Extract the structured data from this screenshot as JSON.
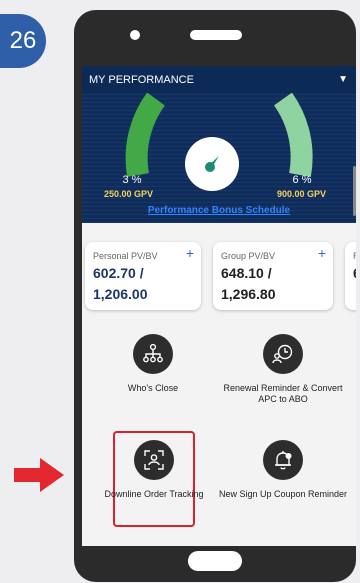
{
  "step": {
    "number": "26"
  },
  "header": {
    "title": "MY PERFORMANCE",
    "toggle_icon": "chevron-down-icon"
  },
  "performance": {
    "left_percent": "3 %",
    "left_gpv": "250.00 GPV",
    "right_percent": "6 %",
    "right_gpv": "900.00 GPV",
    "link_label": "Performance Bonus Schedule",
    "colors": {
      "panel": "#0e2c5c",
      "gauge_left": "#43a947",
      "gauge_right": "#8fd4a0",
      "gpv": "#f2d35b",
      "link": "#2f86ff"
    }
  },
  "cards": [
    {
      "title": "Personal PV/BV",
      "line1": "602.70 /",
      "line2": "1,206.00"
    },
    {
      "title": "Group PV/BV",
      "line1": "648.10 /",
      "line2": "1,296.80"
    },
    {
      "title": "R",
      "line1": "6",
      "line2": ""
    }
  ],
  "actions": [
    {
      "label": "Who's Close",
      "icon": "org-chart-icon"
    },
    {
      "label": "Renewal Reminder & Convert APC to ABO",
      "icon": "person-clock-icon"
    },
    {
      "label": "Downline Order Tracking",
      "icon": "user-scan-icon",
      "highlighted": true
    },
    {
      "label": "New Sign Up Coupon Reminder",
      "icon": "bell-icon"
    }
  ]
}
